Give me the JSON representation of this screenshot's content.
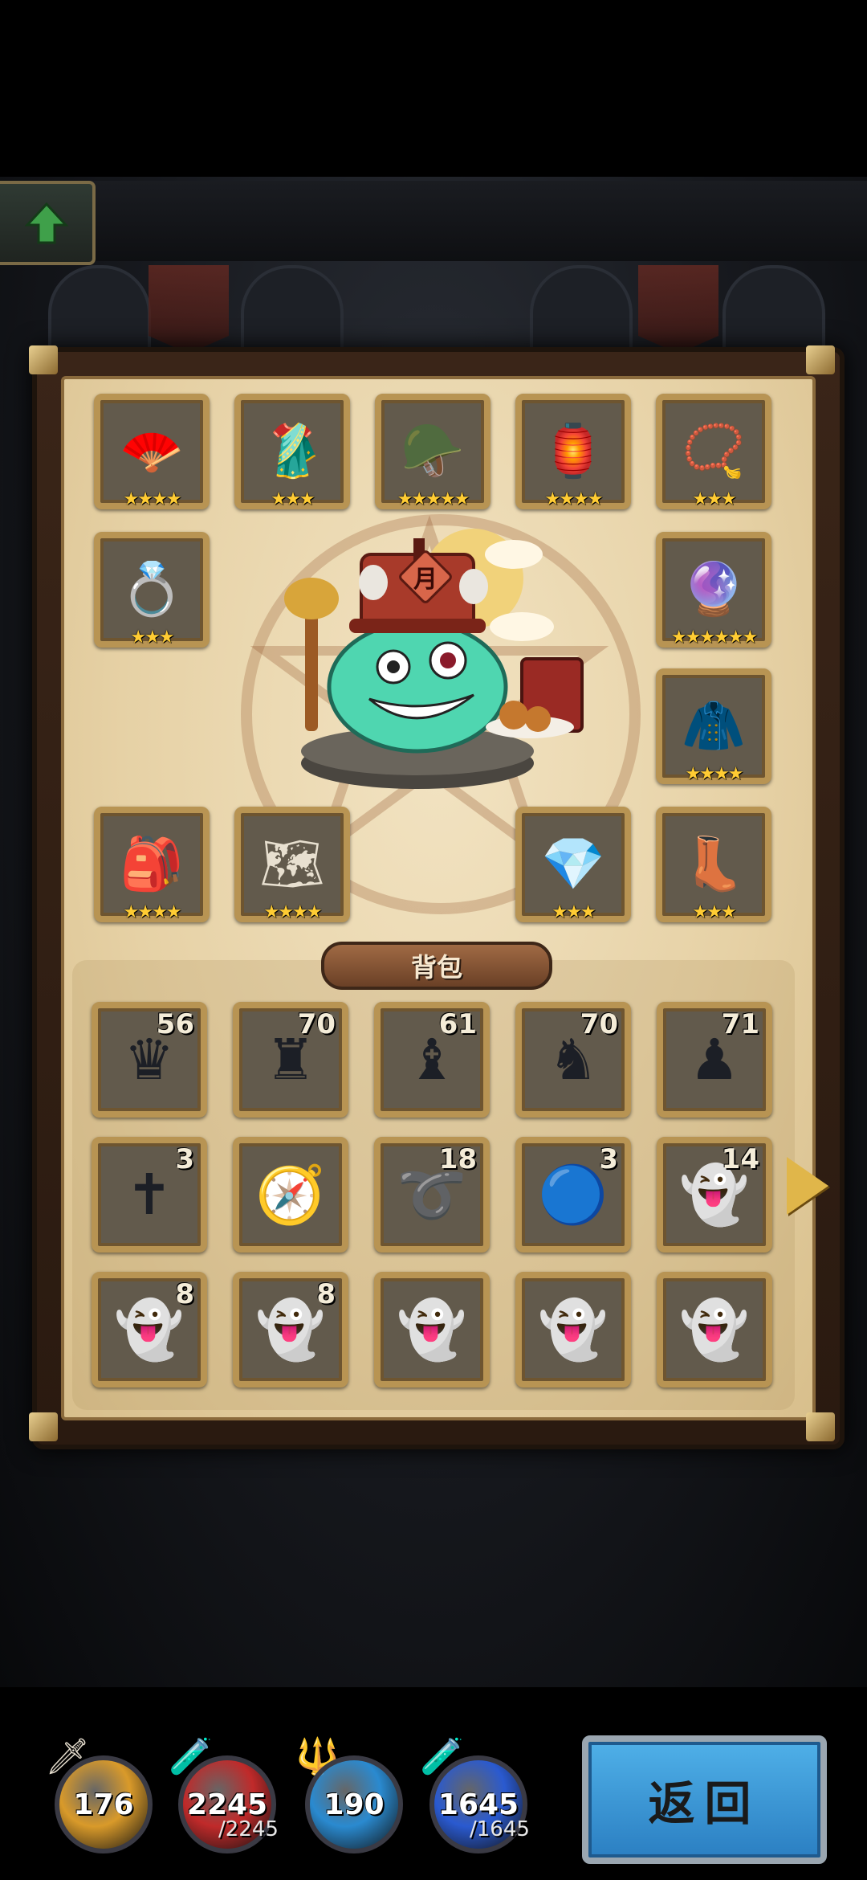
{
  "header": {
    "up_button_icon": "up-arrow-icon"
  },
  "equipment_slots": [
    {
      "id": "fan",
      "icon": "folding-fan-icon",
      "glyph": "🪭",
      "stars": "★★★★"
    },
    {
      "id": "robe",
      "icon": "red-robe-icon",
      "glyph": "🥻",
      "stars": "★★★"
    },
    {
      "id": "chess-helmet",
      "icon": "dark-helmet-icon",
      "glyph": "🪖",
      "stars": "★★★★★"
    },
    {
      "id": "lantern",
      "icon": "purple-lantern-icon",
      "glyph": "🏮",
      "stars": "★★★★"
    },
    {
      "id": "necklace",
      "icon": "necklace-icon",
      "glyph": "📿",
      "stars": "★★★"
    },
    {
      "id": "ring",
      "icon": "gold-ring-icon",
      "glyph": "💍",
      "stars": "★★★"
    },
    {
      "id": "orb-glove",
      "icon": "orb-glove-icon",
      "glyph": "🔮",
      "stars": "★★★★★★"
    },
    {
      "id": "armor",
      "icon": "armor-icon",
      "glyph": "🧥",
      "stars": "★★★★"
    },
    {
      "id": "bag",
      "icon": "backpack-icon",
      "glyph": "🎒",
      "stars": "★★★★"
    },
    {
      "id": "map",
      "icon": "map-tile-icon",
      "glyph": "🗺",
      "stars": "★★★★"
    },
    {
      "id": "crystal",
      "icon": "crystal-icon",
      "glyph": "💎",
      "stars": "★★★"
    },
    {
      "id": "boots",
      "icon": "boots-icon",
      "glyph": "👢",
      "stars": "★★★"
    }
  ],
  "hero": {
    "hat_text": "月",
    "character": "slime-hero"
  },
  "backpack": {
    "title": "背包",
    "items": [
      {
        "icon": "chess-queen-icon",
        "glyph": "♛",
        "count": "56"
      },
      {
        "icon": "chess-rook-icon",
        "glyph": "♜",
        "count": "70"
      },
      {
        "icon": "chess-bishop-icon",
        "glyph": "♝",
        "count": "61"
      },
      {
        "icon": "chess-knight-icon",
        "glyph": "♞",
        "count": "70"
      },
      {
        "icon": "chess-pawn-icon",
        "glyph": "♟",
        "count": "71"
      },
      {
        "icon": "cross-icon",
        "glyph": "✝",
        "count": "3"
      },
      {
        "icon": "compass-icon",
        "glyph": "🧭",
        "count": ""
      },
      {
        "icon": "rope-icon",
        "glyph": "➰",
        "count": "18"
      },
      {
        "icon": "blue-orb-icon",
        "glyph": "🔵",
        "count": "3"
      },
      {
        "icon": "ghost-icon",
        "glyph": "👻",
        "count": "14"
      },
      {
        "icon": "ghost-icon",
        "glyph": "👻",
        "count": "8"
      },
      {
        "icon": "ghost-icon",
        "glyph": "👻",
        "count": "8"
      },
      {
        "icon": "ghost-icon",
        "glyph": "👻",
        "count": ""
      },
      {
        "icon": "ghost-icon",
        "glyph": "👻",
        "count": ""
      },
      {
        "icon": "ghost-icon",
        "glyph": "👻",
        "count": ""
      }
    ]
  },
  "stats": [
    {
      "name": "attack",
      "value": "176",
      "max": "",
      "color": "#d99a2a",
      "tool_glyph": "🗡"
    },
    {
      "name": "hp",
      "value": "2245",
      "max": "/2245",
      "color": "#c02a2a",
      "tool_glyph": "🧪"
    },
    {
      "name": "defense",
      "value": "190",
      "max": "",
      "color": "#2a8ad0",
      "tool_glyph": "🔱"
    },
    {
      "name": "mp",
      "value": "1645",
      "max": "/1645",
      "color": "#2a5ad0",
      "tool_glyph": "🧪"
    }
  ],
  "return_button": {
    "label": "返回"
  }
}
